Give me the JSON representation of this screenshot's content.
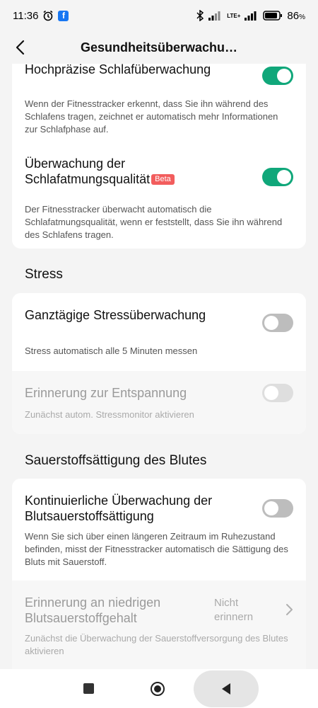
{
  "status_bar": {
    "time": "11:36",
    "network": "LTE+",
    "battery": "86"
  },
  "header": {
    "title": "Gesundheitsüberwachu…"
  },
  "sleep_card": {
    "high_precision": {
      "title": "Hochpräzise Schlafüberwachung",
      "description": "Wenn der Fitnesstracker erkennt, dass Sie ihn während des Schlafens tragen, zeichnet er automatisch mehr Informationen zur Schlafphase auf.",
      "enabled": true
    },
    "breathing_quality": {
      "title_line1": "Überwachung der",
      "title_line2": "Schlafatmungsqualität",
      "badge": "Beta",
      "description": "Der Fitnesstracker überwacht automatisch die Schlafatmungsqualität, wenn er feststellt, dass Sie ihn während des Schlafens tragen.",
      "enabled": true
    }
  },
  "stress_section": {
    "title": "Stress",
    "all_day": {
      "title": "Ganztägige Stressüberwachung",
      "description": "Stress automatisch alle 5 Minuten messen",
      "enabled": false
    },
    "relaxation": {
      "title": "Erinnerung zur Entspannung",
      "description": "Zunächst autom. Stressmonitor aktivieren",
      "enabled": false,
      "disabled": true
    }
  },
  "spo2_section": {
    "title": "Sauerstoffsättigung des Blutes",
    "continuous": {
      "title": "Kontinuierliche Überwachung der Blutsauerstoffsättigung",
      "description": "Wenn Sie sich über einen längeren Zeitraum im Ruhezustand befinden, misst der Fitnesstracker automatisch die Sättigung des Bluts mit Sauerstoff.",
      "enabled": false
    },
    "low_alert": {
      "title": "Erinnerung an niedrigen Blutsauerstoffgehalt",
      "value": "Nicht erinnern",
      "description": "Zunächst die Überwachung der Sauerstoffversorgung des Blutes aktivieren",
      "disabled": true
    }
  },
  "colors": {
    "accent": "#10a77a",
    "beta": "#f25d5d",
    "background": "#f4f4f4"
  }
}
